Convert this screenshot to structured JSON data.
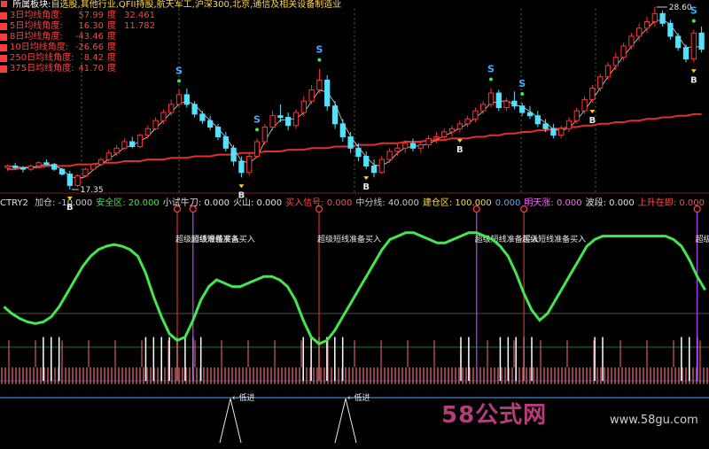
{
  "header": {
    "section_label": "所属板块:",
    "sectors": "自选股,其他行业,QFII持股,航天军工,沪深300,北京,通信及相关设备制造业"
  },
  "legend": [
    {
      "label": "3日均线角度:",
      "v1": "57.99",
      "unit": "度",
      "v2": "32.461",
      "color": "#ff3b3b"
    },
    {
      "label": "5日均线角度:",
      "v1": "16.30",
      "unit": "度",
      "v2": "11.782",
      "color": "#ff3b3b"
    },
    {
      "label": "8日均线角度:",
      "v1": "-43.46",
      "unit": "度",
      "v2": "",
      "color": "#ff3b3b"
    },
    {
      "label": "10日均线角度:",
      "v1": "-26.66",
      "unit": "度",
      "v2": "",
      "color": "#ff3b3b"
    },
    {
      "label": "250日均线角度:",
      "v1": "8.42",
      "unit": "度",
      "v2": "",
      "color": "#ff3b3b"
    },
    {
      "label": "375日均线角度:",
      "v1": "41.70",
      "unit": "度",
      "v2": "",
      "color": "#ff3b3b"
    }
  ],
  "price_labels": {
    "high": "28.60",
    "low": "17.35"
  },
  "indicator_bar": {
    "name": "CTRY2",
    "items": [
      {
        "text": "加仓: -10.000",
        "color": "#c8c8c8"
      },
      {
        "text": "安全区: 20.000",
        "color": "#3fe84a"
      },
      {
        "text": "小试牛刀: 0.000",
        "color": "#e0e0e0"
      },
      {
        "text": "火山: 0.000",
        "color": "#e0e0e0"
      },
      {
        "text": "买入信号: 0.000",
        "color": "#ff4d4d"
      },
      {
        "text": "中分线: 40.000",
        "color": "#c8c8c8"
      },
      {
        "text": "建仓区: 100.000",
        "color": "#ffd84a"
      },
      {
        "text": "0.000",
        "color": "#5aa8ff"
      },
      {
        "text": "明天涨: 0.000",
        "color": "#ff66ff"
      },
      {
        "text": "波段: 0.000",
        "color": "#e0e0e0"
      },
      {
        "text": "上升在即: 0.000",
        "color": "#ff4d4d"
      }
    ]
  },
  "signal_text": "超级短线准备买入",
  "low_entry_text": "低进",
  "watermark": {
    "text": "58公式网",
    "url": "www.58gu.com"
  },
  "colors": {
    "up": "#ff3333",
    "down": "#54e0ff",
    "ma_red": "#e03030",
    "green_line": "#43e64d",
    "magenta": "#c040ff",
    "signal_blue": "#4aa8ff",
    "b_yellow": "#ffd400"
  },
  "chart_data": {
    "type": "candlestick+indicator",
    "price_axis_labels": [
      "28.60",
      "17.35"
    ],
    "candles": [
      [
        18.7,
        18.9,
        18.5,
        18.8
      ],
      [
        18.8,
        19.0,
        18.6,
        18.7
      ],
      [
        18.7,
        18.8,
        18.4,
        18.6
      ],
      [
        18.6,
        18.9,
        18.5,
        18.8
      ],
      [
        18.8,
        19.1,
        18.7,
        19.0
      ],
      [
        19.0,
        19.2,
        18.8,
        18.9
      ],
      [
        18.9,
        19.0,
        18.5,
        18.6
      ],
      [
        18.6,
        18.7,
        18.2,
        18.3
      ],
      [
        18.3,
        18.5,
        17.35,
        17.6
      ],
      [
        17.6,
        18.3,
        17.5,
        18.2
      ],
      [
        18.2,
        18.7,
        18.1,
        18.6
      ],
      [
        18.6,
        19.0,
        18.5,
        18.9
      ],
      [
        18.9,
        19.3,
        18.8,
        19.2
      ],
      [
        19.2,
        19.8,
        19.1,
        19.6
      ],
      [
        19.6,
        20.1,
        19.4,
        19.9
      ],
      [
        19.9,
        20.5,
        19.8,
        20.3
      ],
      [
        20.3,
        20.6,
        19.9,
        20.0
      ],
      [
        20.0,
        20.8,
        19.9,
        20.7
      ],
      [
        20.7,
        21.3,
        20.5,
        21.1
      ],
      [
        21.1,
        21.8,
        21.0,
        21.6
      ],
      [
        21.6,
        22.3,
        21.4,
        22.1
      ],
      [
        22.1,
        22.9,
        21.9,
        22.6
      ],
      [
        22.6,
        23.5,
        22.5,
        23.2
      ],
      [
        23.2,
        23.6,
        22.4,
        22.6
      ],
      [
        22.6,
        22.8,
        21.8,
        22.0
      ],
      [
        22.0,
        22.2,
        21.4,
        21.6
      ],
      [
        21.6,
        21.9,
        21.0,
        21.2
      ],
      [
        21.2,
        21.4,
        20.4,
        20.6
      ],
      [
        20.6,
        20.9,
        19.7,
        19.9
      ],
      [
        19.9,
        20.1,
        18.8,
        19.1
      ],
      [
        19.1,
        19.4,
        18.1,
        18.4
      ],
      [
        18.4,
        19.6,
        18.2,
        19.4
      ],
      [
        19.4,
        20.5,
        19.3,
        20.3
      ],
      [
        20.3,
        21.4,
        20.1,
        21.2
      ],
      [
        21.2,
        22.2,
        21.0,
        21.9
      ],
      [
        21.9,
        22.6,
        21.5,
        21.8
      ],
      [
        21.8,
        22.1,
        21.0,
        21.3
      ],
      [
        21.3,
        22.3,
        21.1,
        22.1
      ],
      [
        22.1,
        23.1,
        21.9,
        22.8
      ],
      [
        22.8,
        23.8,
        22.6,
        23.5
      ],
      [
        23.5,
        24.8,
        23.3,
        24.1
      ],
      [
        24.1,
        24.4,
        22.2,
        22.5
      ],
      [
        22.5,
        22.8,
        21.1,
        21.4
      ],
      [
        21.4,
        21.7,
        20.3,
        20.6
      ],
      [
        20.6,
        20.9,
        19.6,
        19.9
      ],
      [
        19.9,
        20.2,
        19.1,
        19.4
      ],
      [
        19.4,
        19.7,
        18.6,
        18.8
      ],
      [
        18.8,
        19.2,
        18.1,
        18.4
      ],
      [
        18.4,
        19.4,
        18.3,
        19.2
      ],
      [
        19.2,
        19.9,
        19.0,
        19.7
      ],
      [
        19.7,
        20.2,
        19.4,
        19.9
      ],
      [
        19.9,
        20.4,
        19.6,
        20.2
      ],
      [
        20.2,
        20.5,
        19.7,
        19.9
      ],
      [
        19.9,
        20.3,
        19.6,
        20.1
      ],
      [
        20.1,
        20.7,
        19.9,
        20.5
      ],
      [
        20.5,
        20.9,
        20.2,
        20.6
      ],
      [
        20.6,
        21.1,
        20.4,
        20.9
      ],
      [
        20.9,
        21.3,
        20.6,
        21.1
      ],
      [
        21.1,
        21.6,
        20.9,
        21.4
      ],
      [
        21.4,
        21.9,
        21.2,
        21.7
      ],
      [
        21.7,
        22.4,
        21.5,
        22.2
      ],
      [
        22.2,
        22.8,
        22.0,
        22.6
      ],
      [
        22.6,
        23.6,
        22.4,
        23.3
      ],
      [
        23.3,
        23.5,
        22.2,
        22.4
      ],
      [
        22.4,
        23.0,
        22.2,
        22.8
      ],
      [
        22.8,
        23.4,
        22.3,
        22.5
      ],
      [
        22.5,
        22.7,
        21.9,
        22.1
      ],
      [
        22.1,
        22.5,
        21.7,
        21.9
      ],
      [
        21.9,
        22.2,
        21.2,
        21.4
      ],
      [
        21.4,
        21.7,
        20.9,
        21.1
      ],
      [
        21.1,
        21.4,
        20.5,
        20.7
      ],
      [
        20.7,
        21.3,
        20.5,
        21.1
      ],
      [
        21.1,
        21.8,
        20.9,
        21.6
      ],
      [
        21.6,
        22.4,
        21.4,
        22.2
      ],
      [
        22.2,
        23.1,
        22.0,
        22.9
      ],
      [
        22.9,
        23.8,
        22.7,
        23.6
      ],
      [
        23.6,
        24.5,
        23.4,
        24.3
      ],
      [
        24.3,
        25.2,
        24.1,
        25.0
      ],
      [
        25.0,
        25.8,
        24.7,
        25.5
      ],
      [
        25.5,
        26.4,
        25.3,
        26.2
      ],
      [
        26.2,
        27.0,
        26.0,
        26.8
      ],
      [
        26.8,
        27.6,
        26.5,
        27.3
      ],
      [
        27.3,
        28.0,
        27.0,
        27.7
      ],
      [
        27.7,
        28.6,
        27.4,
        28.2
      ],
      [
        28.2,
        28.4,
        27.4,
        27.6
      ],
      [
        27.6,
        27.8,
        26.6,
        26.8
      ],
      [
        26.8,
        27.0,
        25.9,
        26.1
      ],
      [
        26.1,
        26.3,
        25.2,
        25.4
      ],
      [
        25.4,
        27.2,
        25.2,
        27.0
      ],
      [
        27.0,
        27.4,
        25.8,
        26.0
      ]
    ],
    "ma_long": [
      18.6,
      18.6,
      18.7,
      18.7,
      18.7,
      18.8,
      18.8,
      18.8,
      18.8,
      18.9,
      18.9,
      18.9,
      19.0,
      19.0,
      19.0,
      19.1,
      19.1,
      19.1,
      19.2,
      19.2,
      19.2,
      19.3,
      19.3,
      19.3,
      19.4,
      19.4,
      19.4,
      19.5,
      19.5,
      19.5,
      19.6,
      19.6,
      19.6,
      19.7,
      19.7,
      19.7,
      19.8,
      19.8,
      19.8,
      19.9,
      19.9,
      19.9,
      20.0,
      20.0,
      20.0,
      20.1,
      20.1,
      20.1,
      20.2,
      20.2,
      20.2,
      20.3,
      20.3,
      20.3,
      20.4,
      20.4,
      20.4,
      20.5,
      20.5,
      20.5,
      20.6,
      20.6,
      20.7,
      20.7,
      20.8,
      20.8,
      20.9,
      20.9,
      21.0,
      21.0,
      21.1,
      21.1,
      21.2,
      21.2,
      21.3,
      21.3,
      21.4,
      21.4,
      21.5,
      21.5,
      21.6,
      21.6,
      21.7,
      21.7,
      21.8,
      21.8,
      21.9,
      21.9,
      22.0,
      22.0
    ],
    "sell_markers": [
      22,
      32,
      40,
      62,
      66,
      88
    ],
    "buy_markers": [
      8,
      30,
      46,
      58,
      75,
      88
    ],
    "indicator": {
      "green": [
        44,
        40,
        37,
        35,
        34,
        35,
        38,
        44,
        52,
        60,
        68,
        74,
        78,
        80,
        81,
        80,
        78,
        74,
        64,
        50,
        38,
        28,
        24,
        26,
        36,
        48,
        56,
        60,
        58,
        56,
        56,
        58,
        60,
        62,
        62,
        60,
        56,
        48,
        36,
        26,
        22,
        24,
        30,
        38,
        46,
        54,
        62,
        70,
        78,
        84,
        86,
        88,
        88,
        86,
        84,
        82,
        82,
        84,
        86,
        88,
        88,
        86,
        84,
        80,
        74,
        64,
        52,
        42,
        36,
        40,
        48,
        56,
        64,
        72,
        80,
        84,
        86,
        86,
        86,
        86,
        86,
        86,
        86,
        86,
        86,
        84,
        80,
        72,
        62,
        54
      ],
      "signal_idx": [
        22,
        24,
        40,
        60,
        66,
        88
      ],
      "spikes_white": [
        5,
        6,
        7,
        18,
        19,
        20,
        21,
        22,
        23,
        24,
        25,
        38,
        39,
        40,
        41,
        42,
        43,
        58,
        59,
        63,
        64,
        65,
        66,
        67,
        75,
        76,
        86,
        87,
        88
      ]
    }
  }
}
